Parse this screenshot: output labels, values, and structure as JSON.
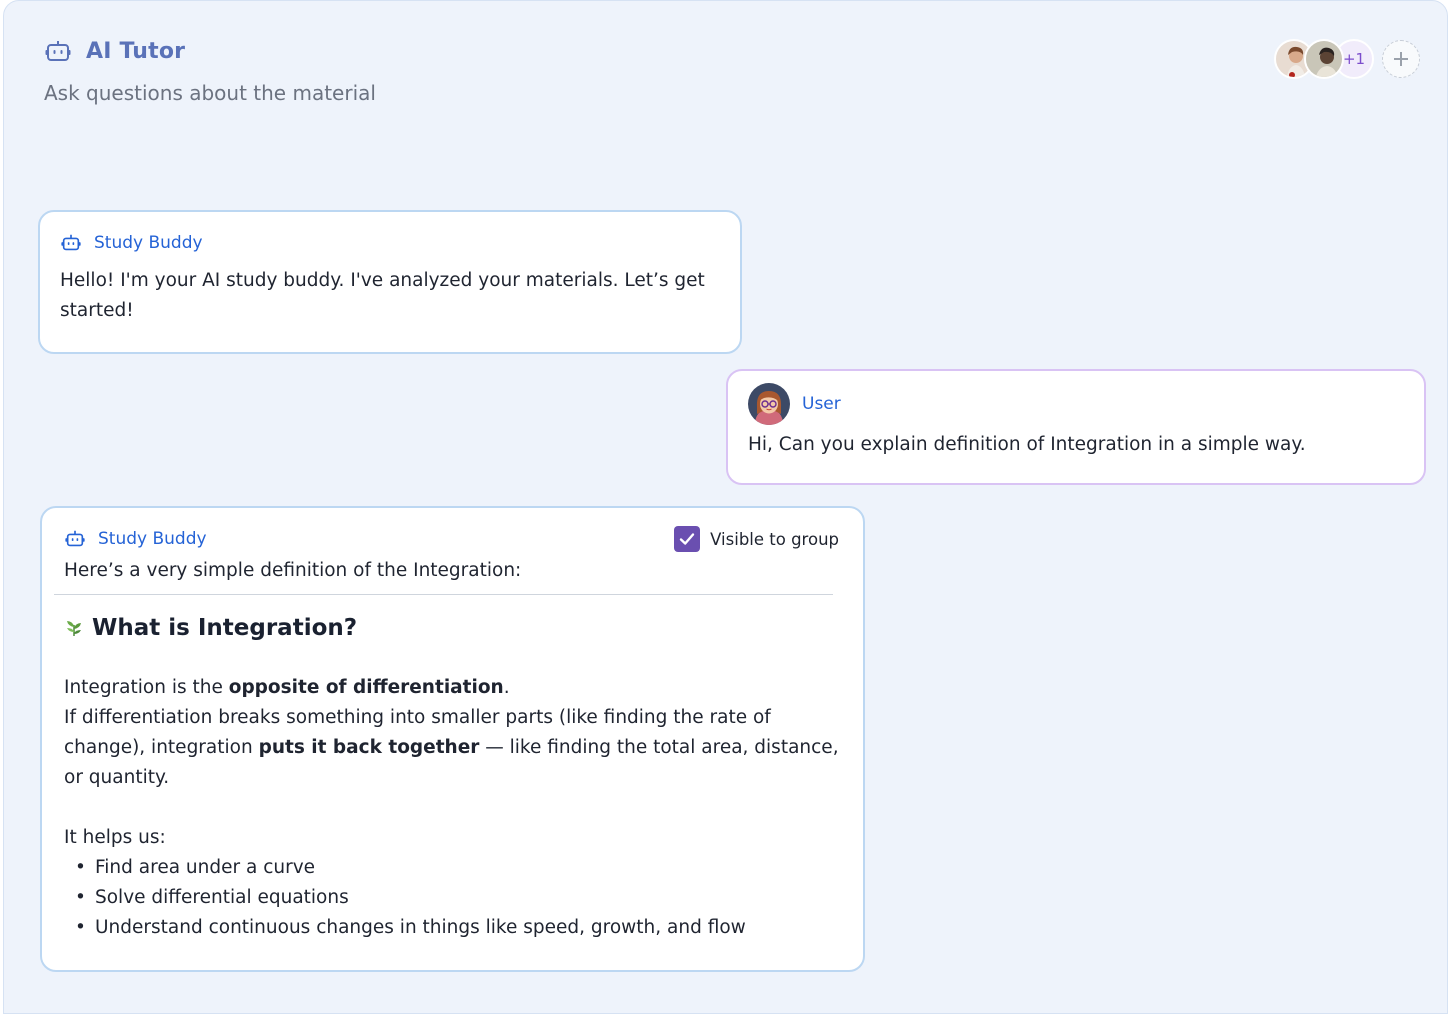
{
  "header": {
    "title": "AI Tutor",
    "subtitle": "Ask questions about the material",
    "participants_extra": "+1",
    "title_icon": "robot-icon",
    "add_icon": "plus-icon"
  },
  "colors": {
    "panel_bg": "#eef3fb",
    "title": "#5a72b8",
    "sender": "#2563d6",
    "ai_border": "#bcd7f2",
    "user_border": "#d9c3f4",
    "checkbox": "#6a4fb0"
  },
  "messages": [
    {
      "role": "ai",
      "sender": "Study Buddy",
      "text": "Hello! I'm your AI study buddy. I've analyzed your materials. Let’s get started!"
    },
    {
      "role": "user",
      "sender": "User",
      "text": "Hi, Can you explain definition of Integration in a simple way."
    },
    {
      "role": "ai",
      "sender": "Study Buddy",
      "visible_label": "Visible to group",
      "visible_checked": true,
      "intro": "Here’s a very simple definition of the Integration:",
      "heading": "What is Integration?",
      "heading_icon": "leaf-icon",
      "p1_a": "Integration is the ",
      "p1_b": "opposite of differentiation",
      "p1_c": ".",
      "p2_a": "If differentiation breaks something into smaller parts (like finding the rate of change), integration ",
      "p2_b": "puts it back together",
      "p2_c": " — like finding the total area, distance, or quantity.",
      "helps": "It helps us:",
      "bullets": [
        "Find area under a curve",
        "Solve differential equations",
        "Understand continuous changes in things like speed, growth, and flow"
      ]
    }
  ]
}
